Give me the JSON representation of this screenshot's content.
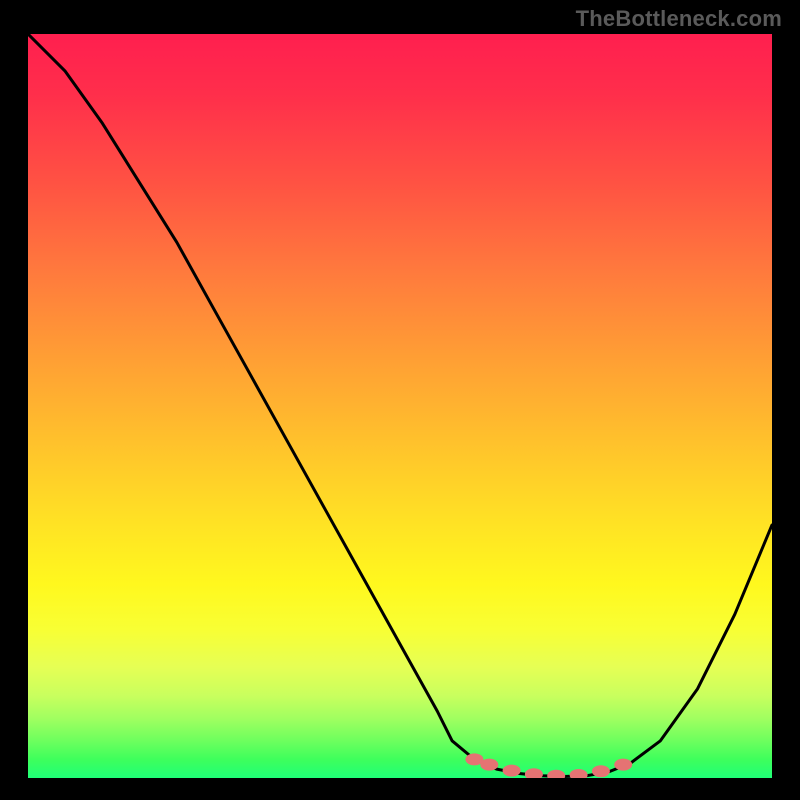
{
  "watermark": "TheBottleneck.com",
  "colors": {
    "curve": "#000000",
    "marker": "#e57373",
    "background_top": "#ff1f4f",
    "background_bottom": "#1fff77"
  },
  "chart_data": {
    "type": "line",
    "title": "",
    "xlabel": "",
    "ylabel": "",
    "xlim": [
      0,
      100
    ],
    "ylim": [
      0,
      100
    ],
    "x": [
      0,
      5,
      10,
      15,
      20,
      25,
      30,
      35,
      40,
      45,
      50,
      55,
      57,
      60,
      63,
      66,
      69,
      72,
      75,
      78,
      81,
      85,
      90,
      95,
      100
    ],
    "y": [
      100,
      95,
      88,
      80,
      72,
      63,
      54,
      45,
      36,
      27,
      18,
      9,
      5,
      2.5,
      1.2,
      0.6,
      0.3,
      0.2,
      0.3,
      0.8,
      2,
      5,
      12,
      22,
      34
    ],
    "markers_x": [
      60,
      62,
      65,
      68,
      71,
      74,
      77,
      80
    ],
    "markers_y": [
      2.5,
      1.8,
      1.0,
      0.5,
      0.3,
      0.4,
      0.9,
      1.8
    ]
  }
}
